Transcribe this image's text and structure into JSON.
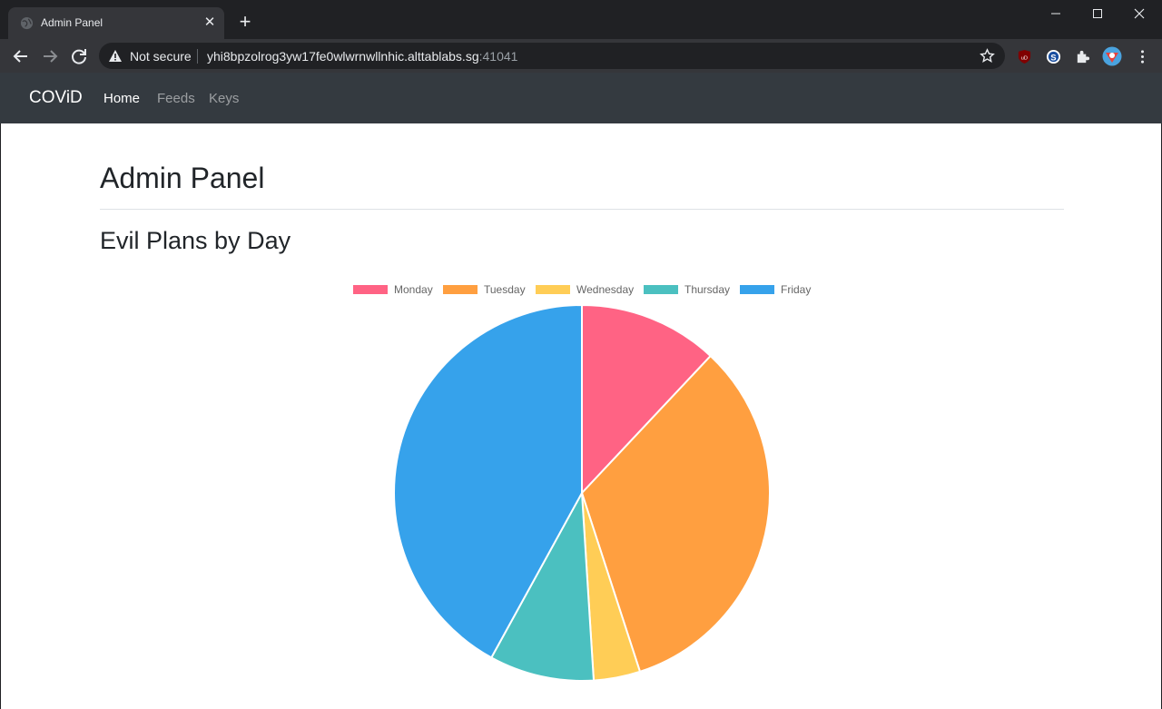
{
  "browser": {
    "tab_title": "Admin Panel",
    "security_label": "Not secure",
    "url_host": "yhi8bpzolrog3yw17fe0wlwrnwllnhic.alttablabs.sg",
    "url_port": ":41041"
  },
  "navbar": {
    "brand": "COViD",
    "links": [
      {
        "label": "Home",
        "active": true
      },
      {
        "label": "Feeds",
        "active": false
      },
      {
        "label": "Keys",
        "active": false
      }
    ]
  },
  "page": {
    "title": "Admin Panel",
    "section_title": "Evil Plans by Day"
  },
  "colors": {
    "Monday": "#ff6384",
    "Tuesday": "#ff9f40",
    "Wednesday": "#ffcd56",
    "Thursday": "#4bc0c0",
    "Friday": "#36a2eb"
  },
  "chart_data": {
    "type": "pie",
    "labels": [
      "Monday",
      "Tuesday",
      "Wednesday",
      "Thursday",
      "Friday"
    ],
    "values": [
      12,
      33,
      4,
      9,
      42
    ],
    "legend_position": "top"
  }
}
